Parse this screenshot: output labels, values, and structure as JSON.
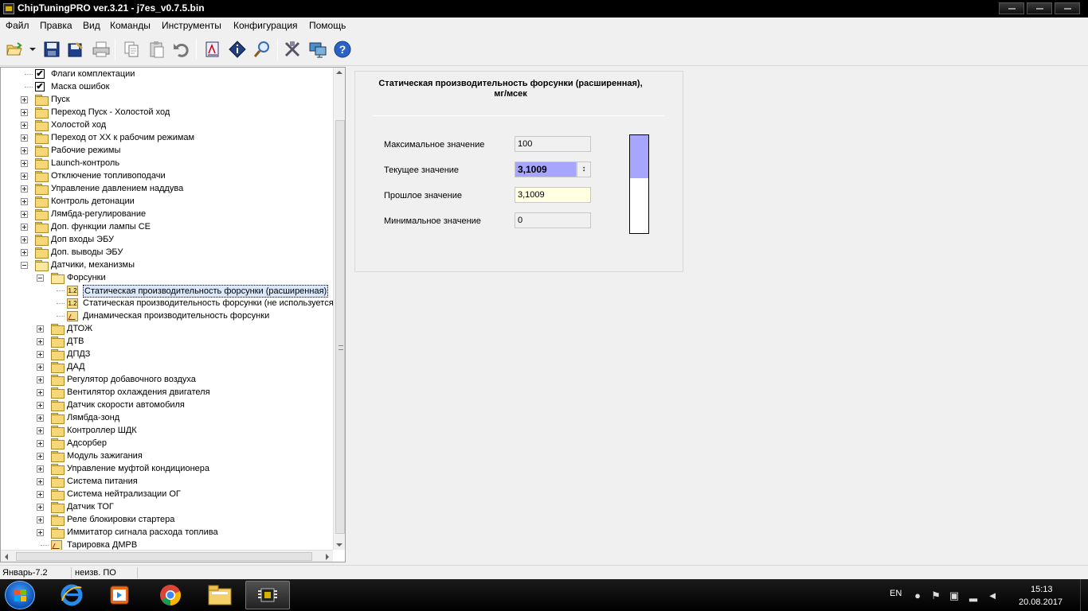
{
  "window": {
    "title": "ChipTuningPRO ver.3.21 - j7es_v0.7.5.bin"
  },
  "menu": [
    "Файл",
    "Правка",
    "Вид",
    "Команды",
    "Инструменты",
    "Конфигурация",
    "Помощь"
  ],
  "toolbar": {
    "buttons": [
      "open-icon",
      "dropdown-arrow-icon",
      "save-icon",
      "save-as-icon",
      "print-icon",
      "copy-icon",
      "paste-icon",
      "undo-icon",
      "edit-table-icon",
      "info-icon",
      "search-icon",
      "tools-icon",
      "network-icon",
      "help-icon"
    ]
  },
  "tree": {
    "items": [
      {
        "label": "Флаги комплектации",
        "level": 1,
        "icon": "checkbox",
        "expander": "none"
      },
      {
        "label": "Маска ошибок",
        "level": 1,
        "icon": "checkbox",
        "expander": "none"
      },
      {
        "label": "Пуск",
        "level": 1,
        "icon": "folder",
        "expander": "plus"
      },
      {
        "label": "Переход Пуск - Холостой ход",
        "level": 1,
        "icon": "folder",
        "expander": "plus"
      },
      {
        "label": "Холостой ход",
        "level": 1,
        "icon": "folder",
        "expander": "plus"
      },
      {
        "label": "Переход от ХХ к рабочим режимам",
        "level": 1,
        "icon": "folder",
        "expander": "plus"
      },
      {
        "label": "Рабочие режимы",
        "level": 1,
        "icon": "folder",
        "expander": "plus"
      },
      {
        "label": "Launch-контроль",
        "level": 1,
        "icon": "folder",
        "expander": "plus"
      },
      {
        "label": "Отключение топливоподачи",
        "level": 1,
        "icon": "folder",
        "expander": "plus"
      },
      {
        "label": "Управление давлением наддува",
        "level": 1,
        "icon": "folder",
        "expander": "plus"
      },
      {
        "label": "Контроль детонации",
        "level": 1,
        "icon": "folder",
        "expander": "plus"
      },
      {
        "label": "Лямбда-регулирование",
        "level": 1,
        "icon": "folder",
        "expander": "plus"
      },
      {
        "label": "Доп. функции лампы СЕ",
        "level": 1,
        "icon": "folder",
        "expander": "plus"
      },
      {
        "label": "Доп входы ЭБУ",
        "level": 1,
        "icon": "folder",
        "expander": "plus"
      },
      {
        "label": "Доп. выводы ЭБУ",
        "level": 1,
        "icon": "folder",
        "expander": "plus"
      },
      {
        "label": "Датчики, механизмы",
        "level": 1,
        "icon": "folder-open",
        "expander": "minus"
      },
      {
        "label": "Форсунки",
        "level": 2,
        "icon": "folder-open",
        "expander": "minus"
      },
      {
        "label": "Статическая производительность форсунки (расширенная)",
        "level": 3,
        "icon": "param",
        "expander": "none",
        "selected": true
      },
      {
        "label": "Статическая производительность форсунки (не используется)",
        "level": 3,
        "icon": "param",
        "expander": "none"
      },
      {
        "label": "Динамическая производительность форсунки",
        "level": 3,
        "icon": "graph",
        "expander": "none"
      },
      {
        "label": "ДТОЖ",
        "level": 2,
        "icon": "folder",
        "expander": "plus"
      },
      {
        "label": "ДТВ",
        "level": 2,
        "icon": "folder",
        "expander": "plus"
      },
      {
        "label": "ДПДЗ",
        "level": 2,
        "icon": "folder",
        "expander": "plus"
      },
      {
        "label": "ДАД",
        "level": 2,
        "icon": "folder",
        "expander": "plus"
      },
      {
        "label": "Регулятор добавочного воздуха",
        "level": 2,
        "icon": "folder",
        "expander": "plus"
      },
      {
        "label": "Вентилятор охлаждения двигателя",
        "level": 2,
        "icon": "folder",
        "expander": "plus"
      },
      {
        "label": "Датчик скорости автомобиля",
        "level": 2,
        "icon": "folder",
        "expander": "plus"
      },
      {
        "label": "Лямбда-зонд",
        "level": 2,
        "icon": "folder",
        "expander": "plus"
      },
      {
        "label": "Контроллер ШДК",
        "level": 2,
        "icon": "folder",
        "expander": "plus"
      },
      {
        "label": "Адсорбер",
        "level": 2,
        "icon": "folder",
        "expander": "plus"
      },
      {
        "label": "Модуль зажигания",
        "level": 2,
        "icon": "folder",
        "expander": "plus"
      },
      {
        "label": "Управление муфтой кондиционера",
        "level": 2,
        "icon": "folder",
        "expander": "plus"
      },
      {
        "label": "Система питания",
        "level": 2,
        "icon": "folder",
        "expander": "plus"
      },
      {
        "label": "Система нейтрализации ОГ",
        "level": 2,
        "icon": "folder",
        "expander": "plus"
      },
      {
        "label": "Датчик ТОГ",
        "level": 2,
        "icon": "folder",
        "expander": "plus"
      },
      {
        "label": "Реле блокировки стартера",
        "level": 2,
        "icon": "folder",
        "expander": "plus"
      },
      {
        "label": "Иммитатор сигнала расхода топлива",
        "level": 2,
        "icon": "folder",
        "expander": "plus"
      },
      {
        "label": "Тарировка ДМРВ",
        "level": 2,
        "icon": "graph",
        "expander": "none"
      }
    ]
  },
  "param": {
    "title": "Статическая производительность форсунки (расширенная),\nмг/мсек",
    "max_label": "Максимальное значение",
    "max_value": "100",
    "current_label": "Текущее значение",
    "current_value": "3,1009",
    "prev_label": "Прошлое значение",
    "prev_value": "3,1009",
    "min_label": "Минимальное значение",
    "min_value": "0",
    "level_fraction": 0.44,
    "level_color": "#a6a6ff"
  },
  "status": {
    "firmware": "Январь-7.2",
    "state": "неизв. ПО"
  },
  "taskbar": {
    "apps": [
      "windows-start-icon",
      "internet-explorer-icon",
      "media-player-icon",
      "chrome-icon",
      "file-explorer-icon",
      "chiptuning-chip-icon"
    ],
    "language": "EN",
    "time": "15:13",
    "date": "20.08.2017"
  }
}
